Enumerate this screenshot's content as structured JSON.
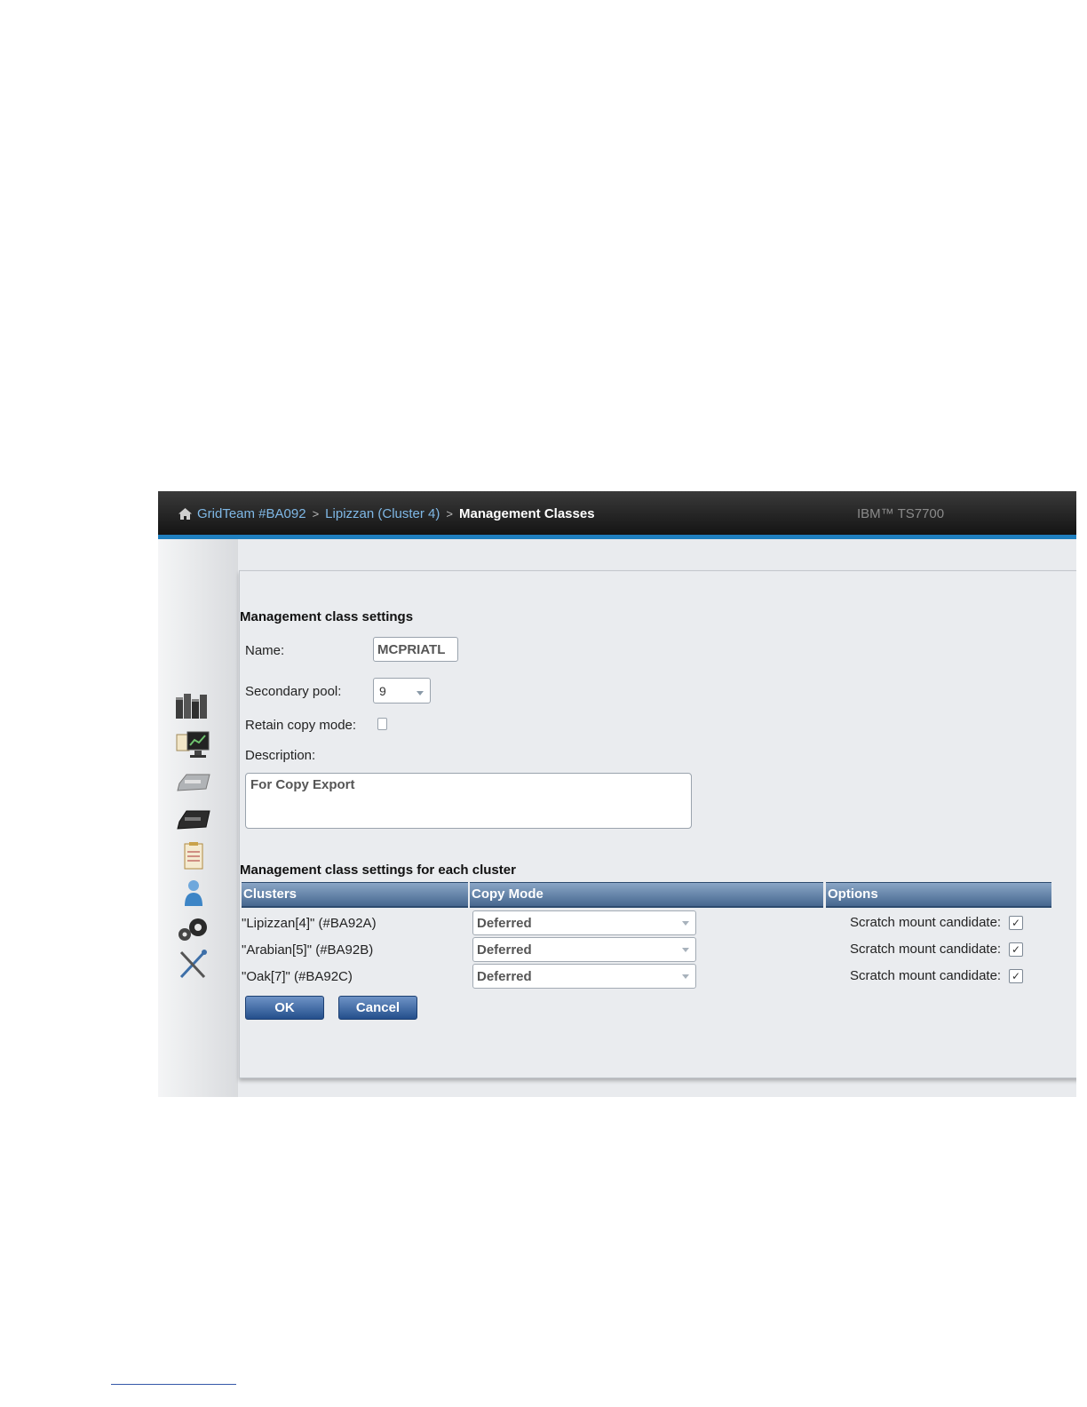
{
  "breadcrumb": {
    "grid": "GridTeam #BA092",
    "separator": ">",
    "cluster": "Lipizzan (Cluster 4)",
    "current": "Management Classes"
  },
  "product": "IBM™ TS7700",
  "sidebar": {
    "items": [
      {
        "icon": "monitor-grid-icon"
      },
      {
        "icon": "performance-monitor-icon"
      },
      {
        "icon": "virtual-drive-icon"
      },
      {
        "icon": "physical-drive-icon"
      },
      {
        "icon": "constructs-clipboard-icon"
      },
      {
        "icon": "user-access-icon"
      },
      {
        "icon": "settings-gears-icon"
      },
      {
        "icon": "service-tools-icon"
      }
    ]
  },
  "settings": {
    "title": "Management class settings",
    "name_label": "Name:",
    "name_value": "MCPRIATL",
    "secondary_pool_label": "Secondary pool:",
    "secondary_pool_value": "9",
    "retain_copy_mode_label": "Retain copy mode:",
    "description_label": "Description:",
    "description_value": "For Copy Export"
  },
  "cluster_settings": {
    "title": "Management class settings for each cluster",
    "columns": [
      "Clusters",
      "Copy Mode",
      "Options"
    ],
    "rows": [
      {
        "cluster": "\"Lipizzan[4]\" (#BA92A)",
        "copy_mode": "Deferred",
        "option_label": "Scratch mount candidate:",
        "checked": true
      },
      {
        "cluster": "\"Arabian[5]\" (#BA92B)",
        "copy_mode": "Deferred",
        "option_label": "Scratch mount candidate:",
        "checked": true
      },
      {
        "cluster": "\"Oak[7]\" (#BA92C)",
        "copy_mode": "Deferred",
        "option_label": "Scratch mount candidate:",
        "checked": true
      }
    ]
  },
  "buttons": {
    "ok": "OK",
    "cancel": "Cancel"
  },
  "check_glyph": "✓"
}
